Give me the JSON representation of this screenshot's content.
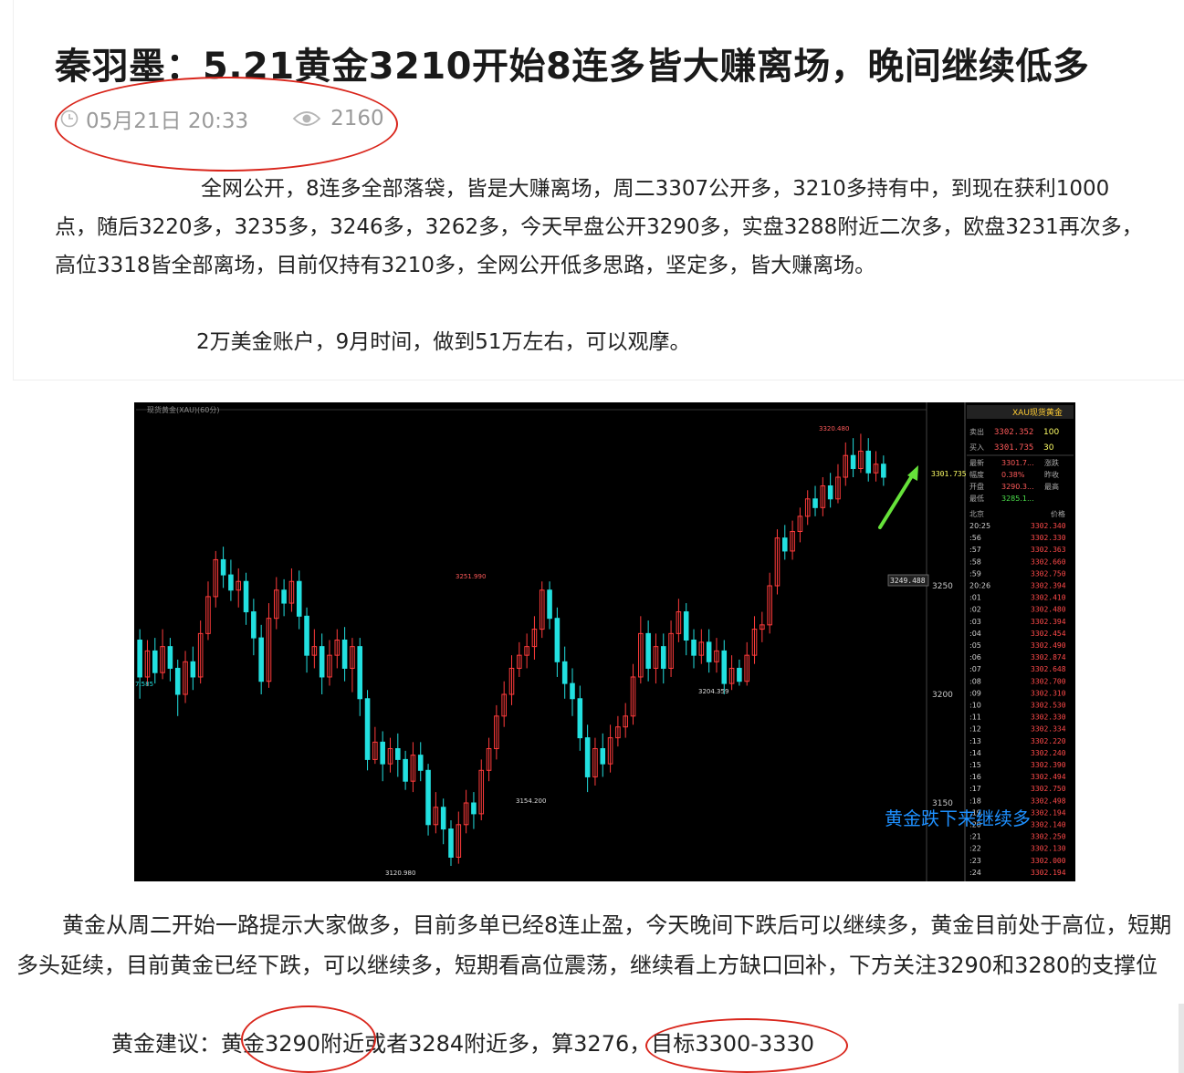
{
  "article": {
    "title": "秦羽墨：5.21黄金3210开始8连多皆大赚离场，晚间继续低多",
    "date": "05月21日 20:33",
    "views": "2160",
    "para1": "全网公开，8连多全部落袋，皆是大赚离场，周二3307公开多，3210多持有中，到现在获利1000点，随后3220多，3235多，3246多，3262多，今天早盘公开3290多，实盘3288附近二次多，欧盘3231再次多，高位3318皆全部离场，目前仅持有3210多，全网公开低多思路，坚定多，皆大赚离场。",
    "para2": "2万美金账户，9月时间，做到51万左右，可以观摩。",
    "para3": "黄金从周二开始一路提示大家做多，目前多单已经8连止盈，今天晚间下跌后可以继续多，黄金目前处于高位，短期多头延续，目前黄金已经下跌，可以继续多，短期看高位震荡，继续看上方缺口回补，下方关注3290和3280的支撑位",
    "advice": "黄金建议：黄金3290附近或者3284附近多，算3276，目标3300-3330"
  },
  "icons": {
    "clock": "clock-icon",
    "views": "eye-icon"
  },
  "colors": {
    "annotation_ring": "#d9261c",
    "up_candle": "#ff3b3b",
    "down_candle": "#22e0e0",
    "overlay_text": "#1e90ff"
  },
  "chart_data": {
    "type": "candlestick",
    "header_label": "现货黄金(XAU)(60分)",
    "panel_title": "XAU现货黄金",
    "overlay_text": "黄金跌下来继续多",
    "y_ticks": [
      "3250",
      "3200",
      "3150"
    ],
    "price_tag": "3249.488",
    "last_price_tag": "3301.735",
    "left_edge_label": "7.585",
    "annotations": [
      "3320.480",
      "3251.990",
      "3204.359",
      "3154.200",
      "3120.980"
    ],
    "quote": {
      "sell": {
        "label": "卖出",
        "price": "3302.352",
        "qty": "100"
      },
      "buy": {
        "label": "买入",
        "price": "3301.735",
        "qty": "30"
      },
      "rows": [
        {
          "k1": "最新",
          "v1": "3301.7...",
          "k2": "涨跌"
        },
        {
          "k1": "幅度",
          "v1": "0.38%",
          "k2": "昨收"
        },
        {
          "k1": "开盘",
          "v1": "3290.3...",
          "k2": "最高"
        },
        {
          "k1": "最低",
          "v1": "3285.1...",
          "k2": ""
        }
      ],
      "tick_header": {
        "time": "北京",
        "price": "价格"
      },
      "ticks": [
        {
          "t": "20:25",
          "p": "3302.340"
        },
        {
          "t": ":56",
          "p": "3302.330"
        },
        {
          "t": ":57",
          "p": "3302.363"
        },
        {
          "t": ":58",
          "p": "3302.660"
        },
        {
          "t": ":59",
          "p": "3302.750"
        },
        {
          "t": "20:26",
          "p": "3302.394"
        },
        {
          "t": ":01",
          "p": "3302.410"
        },
        {
          "t": ":02",
          "p": "3302.480"
        },
        {
          "t": ":03",
          "p": "3302.394"
        },
        {
          "t": ":04",
          "p": "3302.454"
        },
        {
          "t": ":05",
          "p": "3302.490"
        },
        {
          "t": ":06",
          "p": "3302.874"
        },
        {
          "t": ":07",
          "p": "3302.648"
        },
        {
          "t": ":08",
          "p": "3302.700"
        },
        {
          "t": ":09",
          "p": "3302.310"
        },
        {
          "t": ":10",
          "p": "3302.530"
        },
        {
          "t": ":11",
          "p": "3302.330"
        },
        {
          "t": ":12",
          "p": "3302.334"
        },
        {
          "t": ":13",
          "p": "3302.220"
        },
        {
          "t": ":14",
          "p": "3302.240"
        },
        {
          "t": ":15",
          "p": "3302.390"
        },
        {
          "t": ":16",
          "p": "3302.494"
        },
        {
          "t": ":17",
          "p": "3302.750"
        },
        {
          "t": ":18",
          "p": "3302.498"
        },
        {
          "t": ":19",
          "p": "3302.194"
        },
        {
          "t": ":20",
          "p": "3302.140"
        },
        {
          "t": ":21",
          "p": "3302.250"
        },
        {
          "t": ":22",
          "p": "3302.130"
        },
        {
          "t": ":23",
          "p": "3302.000"
        },
        {
          "t": ":24",
          "p": "3302.194"
        }
      ]
    },
    "candles": [
      {
        "o": 3225,
        "c": 3208,
        "h": 3230,
        "l": 3198
      },
      {
        "o": 3208,
        "c": 3220,
        "h": 3225,
        "l": 3204
      },
      {
        "o": 3220,
        "c": 3210,
        "h": 3226,
        "l": 3205
      },
      {
        "o": 3210,
        "c": 3222,
        "h": 3230,
        "l": 3207
      },
      {
        "o": 3222,
        "c": 3212,
        "h": 3226,
        "l": 3206
      },
      {
        "o": 3212,
        "c": 3200,
        "h": 3216,
        "l": 3190
      },
      {
        "o": 3200,
        "c": 3215,
        "h": 3220,
        "l": 3196
      },
      {
        "o": 3215,
        "c": 3208,
        "h": 3222,
        "l": 3202
      },
      {
        "o": 3208,
        "c": 3228,
        "h": 3234,
        "l": 3205
      },
      {
        "o": 3228,
        "c": 3245,
        "h": 3252,
        "l": 3225
      },
      {
        "o": 3245,
        "c": 3262,
        "h": 3266,
        "l": 3240
      },
      {
        "o": 3262,
        "c": 3255,
        "h": 3268,
        "l": 3249
      },
      {
        "o": 3255,
        "c": 3248,
        "h": 3262,
        "l": 3243
      },
      {
        "o": 3248,
        "c": 3252,
        "h": 3258,
        "l": 3240
      },
      {
        "o": 3252,
        "c": 3238,
        "h": 3256,
        "l": 3232
      },
      {
        "o": 3238,
        "c": 3226,
        "h": 3244,
        "l": 3218
      },
      {
        "o": 3226,
        "c": 3206,
        "h": 3232,
        "l": 3200
      },
      {
        "o": 3206,
        "c": 3235,
        "h": 3242,
        "l": 3203
      },
      {
        "o": 3235,
        "c": 3248,
        "h": 3254,
        "l": 3230
      },
      {
        "o": 3248,
        "c": 3242,
        "h": 3253,
        "l": 3236
      },
      {
        "o": 3242,
        "c": 3252,
        "h": 3258,
        "l": 3238
      },
      {
        "o": 3252,
        "c": 3236,
        "h": 3257,
        "l": 3230
      },
      {
        "o": 3236,
        "c": 3218,
        "h": 3240,
        "l": 3210
      },
      {
        "o": 3218,
        "c": 3222,
        "h": 3230,
        "l": 3212
      },
      {
        "o": 3222,
        "c": 3208,
        "h": 3228,
        "l": 3200
      },
      {
        "o": 3208,
        "c": 3218,
        "h": 3225,
        "l": 3204
      },
      {
        "o": 3218,
        "c": 3225,
        "h": 3230,
        "l": 3212
      },
      {
        "o": 3225,
        "c": 3212,
        "h": 3231,
        "l": 3206
      },
      {
        "o": 3212,
        "c": 3222,
        "h": 3226,
        "l": 3201
      },
      {
        "o": 3222,
        "c": 3198,
        "h": 3226,
        "l": 3190
      },
      {
        "o": 3198,
        "c": 3170,
        "h": 3202,
        "l": 3165
      },
      {
        "o": 3170,
        "c": 3178,
        "h": 3185,
        "l": 3168
      },
      {
        "o": 3178,
        "c": 3168,
        "h": 3183,
        "l": 3160
      },
      {
        "o": 3168,
        "c": 3175,
        "h": 3180,
        "l": 3164
      },
      {
        "o": 3175,
        "c": 3170,
        "h": 3182,
        "l": 3162
      },
      {
        "o": 3170,
        "c": 3160,
        "h": 3174,
        "l": 3156
      },
      {
        "o": 3160,
        "c": 3172,
        "h": 3178,
        "l": 3155
      },
      {
        "o": 3172,
        "c": 3165,
        "h": 3178,
        "l": 3160
      },
      {
        "o": 3165,
        "c": 3140,
        "h": 3168,
        "l": 3135
      },
      {
        "o": 3140,
        "c": 3148,
        "h": 3155,
        "l": 3136
      },
      {
        "o": 3148,
        "c": 3138,
        "h": 3152,
        "l": 3131
      },
      {
        "o": 3138,
        "c": 3125,
        "h": 3142,
        "l": 3121
      },
      {
        "o": 3125,
        "c": 3140,
        "h": 3146,
        "l": 3122
      },
      {
        "o": 3140,
        "c": 3150,
        "h": 3156,
        "l": 3136
      },
      {
        "o": 3150,
        "c": 3145,
        "h": 3155,
        "l": 3138
      },
      {
        "o": 3145,
        "c": 3165,
        "h": 3170,
        "l": 3142
      },
      {
        "o": 3165,
        "c": 3175,
        "h": 3180,
        "l": 3160
      },
      {
        "o": 3175,
        "c": 3190,
        "h": 3195,
        "l": 3170
      },
      {
        "o": 3190,
        "c": 3200,
        "h": 3206,
        "l": 3185
      },
      {
        "o": 3200,
        "c": 3212,
        "h": 3218,
        "l": 3195
      },
      {
        "o": 3212,
        "c": 3218,
        "h": 3224,
        "l": 3208
      },
      {
        "o": 3218,
        "c": 3222,
        "h": 3228,
        "l": 3212
      },
      {
        "o": 3222,
        "c": 3230,
        "h": 3236,
        "l": 3216
      },
      {
        "o": 3230,
        "c": 3248,
        "h": 3252,
        "l": 3226
      },
      {
        "o": 3248,
        "c": 3235,
        "h": 3252,
        "l": 3230
      },
      {
        "o": 3235,
        "c": 3215,
        "h": 3240,
        "l": 3208
      },
      {
        "o": 3215,
        "c": 3205,
        "h": 3222,
        "l": 3198
      },
      {
        "o": 3205,
        "c": 3198,
        "h": 3212,
        "l": 3190
      },
      {
        "o": 3198,
        "c": 3180,
        "h": 3204,
        "l": 3174
      },
      {
        "o": 3180,
        "c": 3162,
        "h": 3186,
        "l": 3155
      },
      {
        "o": 3162,
        "c": 3175,
        "h": 3180,
        "l": 3158
      },
      {
        "o": 3175,
        "c": 3168,
        "h": 3182,
        "l": 3162
      },
      {
        "o": 3168,
        "c": 3180,
        "h": 3186,
        "l": 3164
      },
      {
        "o": 3180,
        "c": 3185,
        "h": 3190,
        "l": 3176
      },
      {
        "o": 3185,
        "c": 3190,
        "h": 3196,
        "l": 3180
      },
      {
        "o": 3190,
        "c": 3208,
        "h": 3214,
        "l": 3186
      },
      {
        "o": 3208,
        "c": 3228,
        "h": 3236,
        "l": 3205
      },
      {
        "o": 3228,
        "c": 3212,
        "h": 3234,
        "l": 3206
      },
      {
        "o": 3212,
        "c": 3222,
        "h": 3228,
        "l": 3205
      },
      {
        "o": 3222,
        "c": 3212,
        "h": 3228,
        "l": 3205
      },
      {
        "o": 3212,
        "c": 3228,
        "h": 3234,
        "l": 3208
      },
      {
        "o": 3228,
        "c": 3238,
        "h": 3244,
        "l": 3224
      },
      {
        "o": 3238,
        "c": 3225,
        "h": 3242,
        "l": 3218
      },
      {
        "o": 3225,
        "c": 3218,
        "h": 3230,
        "l": 3212
      },
      {
        "o": 3218,
        "c": 3224,
        "h": 3230,
        "l": 3214
      },
      {
        "o": 3224,
        "c": 3215,
        "h": 3230,
        "l": 3210
      },
      {
        "o": 3215,
        "c": 3220,
        "h": 3226,
        "l": 3210
      },
      {
        "o": 3220,
        "c": 3205,
        "h": 3225,
        "l": 3200
      },
      {
        "o": 3205,
        "c": 3212,
        "h": 3218,
        "l": 3202
      },
      {
        "o": 3212,
        "c": 3206,
        "h": 3216,
        "l": 3204
      },
      {
        "o": 3206,
        "c": 3218,
        "h": 3224,
        "l": 3204
      },
      {
        "o": 3218,
        "c": 3230,
        "h": 3236,
        "l": 3214
      },
      {
        "o": 3230,
        "c": 3232,
        "h": 3238,
        "l": 3224
      },
      {
        "o": 3232,
        "c": 3250,
        "h": 3256,
        "l": 3228
      },
      {
        "o": 3250,
        "c": 3272,
        "h": 3276,
        "l": 3246
      },
      {
        "o": 3272,
        "c": 3266,
        "h": 3278,
        "l": 3262
      },
      {
        "o": 3266,
        "c": 3275,
        "h": 3280,
        "l": 3262
      },
      {
        "o": 3275,
        "c": 3282,
        "h": 3286,
        "l": 3270
      },
      {
        "o": 3282,
        "c": 3290,
        "h": 3294,
        "l": 3278
      },
      {
        "o": 3290,
        "c": 3286,
        "h": 3296,
        "l": 3282
      },
      {
        "o": 3286,
        "c": 3296,
        "h": 3300,
        "l": 3282
      },
      {
        "o": 3296,
        "c": 3290,
        "h": 3302,
        "l": 3286
      },
      {
        "o": 3290,
        "c": 3300,
        "h": 3306,
        "l": 3288
      },
      {
        "o": 3300,
        "c": 3310,
        "h": 3316,
        "l": 3296
      },
      {
        "o": 3310,
        "c": 3304,
        "h": 3318,
        "l": 3300
      },
      {
        "o": 3304,
        "c": 3312,
        "h": 3320,
        "l": 3302
      },
      {
        "o": 3312,
        "c": 3302,
        "h": 3318,
        "l": 3298
      },
      {
        "o": 3302,
        "c": 3306,
        "h": 3312,
        "l": 3298
      },
      {
        "o": 3306,
        "c": 3300,
        "h": 3310,
        "l": 3296
      }
    ]
  }
}
